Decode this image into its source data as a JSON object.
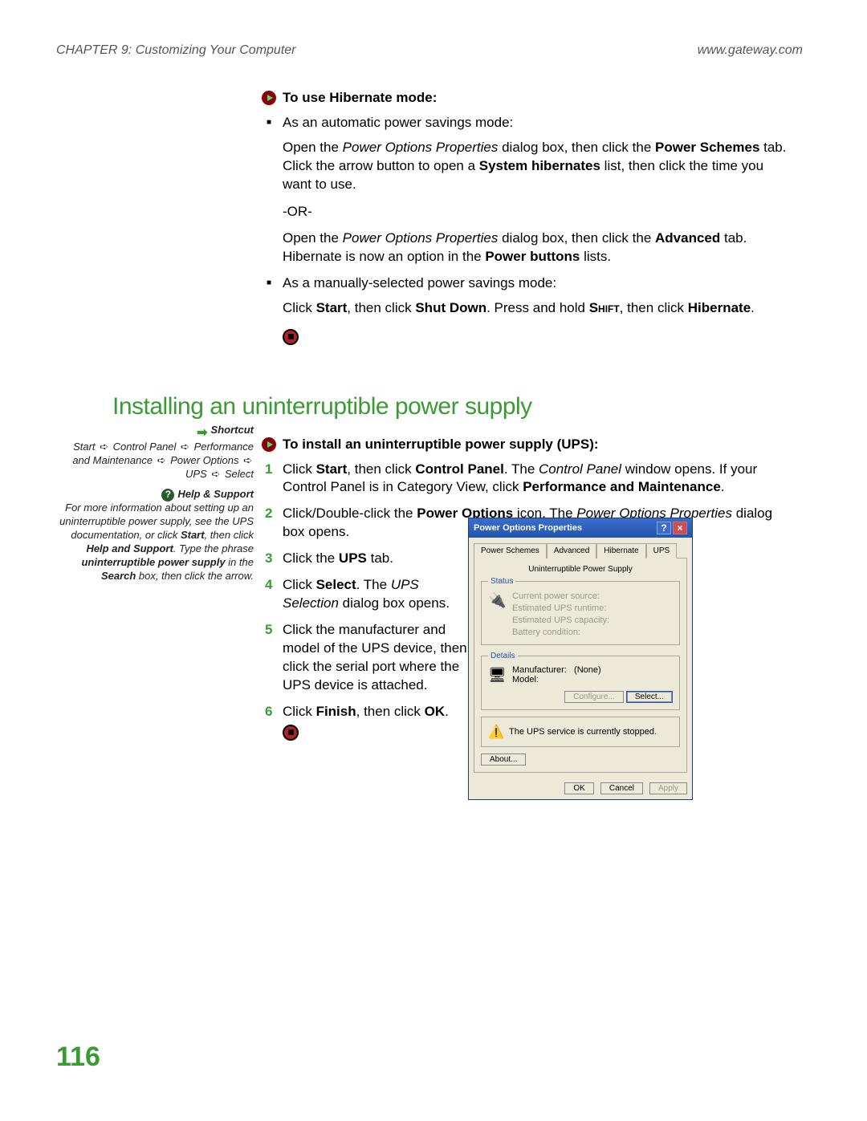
{
  "header": {
    "chapter": "CHAPTER 9: Customizing Your Computer",
    "url": "www.gateway.com"
  },
  "proc1": {
    "title": "To use Hibernate mode:",
    "b1_lead": "As an automatic power savings mode:",
    "b1_p1_a": "Open the ",
    "b1_p1_i": "Power Options Properties",
    "b1_p1_b": " dialog box, then click the ",
    "b1_p1_bold1": "Power Schemes",
    "b1_p1_c": " tab. Click the arrow button to open a ",
    "b1_p1_bold2": "System hibernates",
    "b1_p1_d": " list, then click the time you want to use.",
    "or": "-OR-",
    "b1_p2_a": "Open the ",
    "b1_p2_i": "Power Options Properties",
    "b1_p2_b": " dialog box, then click the ",
    "b1_p2_bold1": "Advanced",
    "b1_p2_c": " tab. Hibernate is now an option in the ",
    "b1_p2_bold2": "Power buttons",
    "b1_p2_d": " lists.",
    "b2_lead": "As a manually-selected power savings mode:",
    "b2_p_a": "Click ",
    "b2_p_bold1": "Start",
    "b2_p_b": ", then click ",
    "b2_p_bold2": "Shut Down",
    "b2_p_c": ". Press and hold ",
    "b2_p_sc": "Shift",
    "b2_p_d": ", then click ",
    "b2_p_bold3": "Hibernate",
    "b2_p_e": "."
  },
  "h2": "Installing an uninterruptible power supply",
  "proc2": {
    "title": "To install an uninterruptible power supply (UPS):",
    "s1_num": "1",
    "s1_a": "Click ",
    "s1_b1": "Start",
    "s1_b": ", then click ",
    "s1_b2": "Control Panel",
    "s1_c": ". The ",
    "s1_i": "Control Panel",
    "s1_d": " window opens. If your Control Panel is in Category View, click ",
    "s1_b3": "Performance and Maintenance",
    "s1_e": ".",
    "s2_num": "2",
    "s2_a": "Click/Double-click the ",
    "s2_b1": "Power Options",
    "s2_b": " icon. The ",
    "s2_i": "Power Options Properties",
    "s2_c": " dialog box opens.",
    "s3_num": "3",
    "s3_a": "Click the ",
    "s3_b1": "UPS",
    "s3_b": " tab.",
    "s4_num": "4",
    "s4_a": "Click ",
    "s4_b1": "Select",
    "s4_b": ". The ",
    "s4_i": "UPS Selection",
    "s4_c": " dialog box opens.",
    "s5_num": "5",
    "s5_a": "Click the manufacturer and model of the UPS device, then click the serial port where the UPS device is attached.",
    "s6_num": "6",
    "s6_a": "Click ",
    "s6_b1": "Finish",
    "s6_b": ", then click ",
    "s6_b2": "OK",
    "s6_c": "."
  },
  "side": {
    "shortcut_hd": "Shortcut",
    "shortcut_txt_a": "Start ",
    "shortcut_txt_b": " Control Panel ",
    "shortcut_txt_c": " Performance and Maintenance ",
    "shortcut_txt_d": " Power Options ",
    "shortcut_txt_e": " UPS ",
    "shortcut_txt_f": " Select",
    "help_hd": "Help & Support",
    "help_a": "For more information about setting up an uninterruptible power supply, see the UPS documentation, or click ",
    "help_b1": "Start",
    "help_b": ", then click ",
    "help_b2": "Help and Support",
    "help_c": ". Type the phrase ",
    "help_bi": "uninterruptible power supply",
    "help_d": " in the ",
    "help_b3": "Search",
    "help_e": " box, then click the arrow."
  },
  "dialog": {
    "title": "Power Options Properties",
    "tabs": [
      "Power Schemes",
      "Advanced",
      "Hibernate",
      "UPS"
    ],
    "active_tab": "UPS",
    "group_title": "Uninterruptible Power Supply",
    "status_legend": "Status",
    "status_lines": [
      "Current power source:",
      "Estimated UPS runtime:",
      "Estimated UPS capacity:",
      "Battery condition:"
    ],
    "details_legend": "Details",
    "manufacturer_label": "Manufacturer:",
    "manufacturer_value": "(None)",
    "model_label": "Model:",
    "configure_btn": "Configure...",
    "select_btn": "Select...",
    "warn_text": "The UPS service is currently stopped.",
    "about_btn": "About...",
    "ok": "OK",
    "cancel": "Cancel",
    "apply": "Apply"
  },
  "page_num": "116"
}
